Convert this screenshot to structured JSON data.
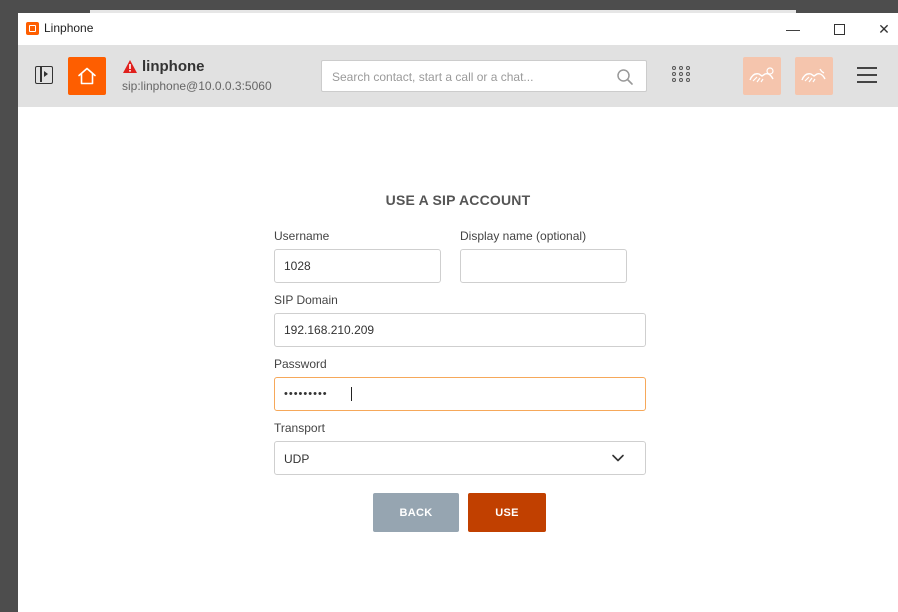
{
  "window": {
    "title": "Linphone",
    "controls": {
      "minimize": "—",
      "maximize": "",
      "close": "✕"
    }
  },
  "toolbar": {
    "account_name": "linphone",
    "account_sip": "sip:linphone@10.0.0.3:5060",
    "account_status": "warning",
    "search_placeholder": "Search contact, start a call or a chat...",
    "icons": [
      "sidebar-toggle-icon",
      "home-icon",
      "warning-icon",
      "search-icon",
      "dialpad-icon",
      "conference-icon",
      "conference-call-icon",
      "menu-icon"
    ]
  },
  "form": {
    "title": "USE A SIP ACCOUNT",
    "username_label": "Username",
    "username_value": "1028",
    "display_name_label": "Display name (optional)",
    "display_name_value": "",
    "domain_label": "SIP Domain",
    "domain_value": "192.168.210.209",
    "password_label": "Password",
    "password_value": "•••••••••",
    "transport_label": "Transport",
    "transport_value": "UDP",
    "back_label": "BACK",
    "use_label": "USE"
  },
  "colors": {
    "accent": "#fe5e00",
    "accent_light": "#f5c5ad",
    "use_button": "#c14000",
    "back_button": "#96a5b1",
    "toolbar_bg": "#e1e1e1",
    "focus_border": "#f6a85a",
    "warning": "#e0201d"
  }
}
